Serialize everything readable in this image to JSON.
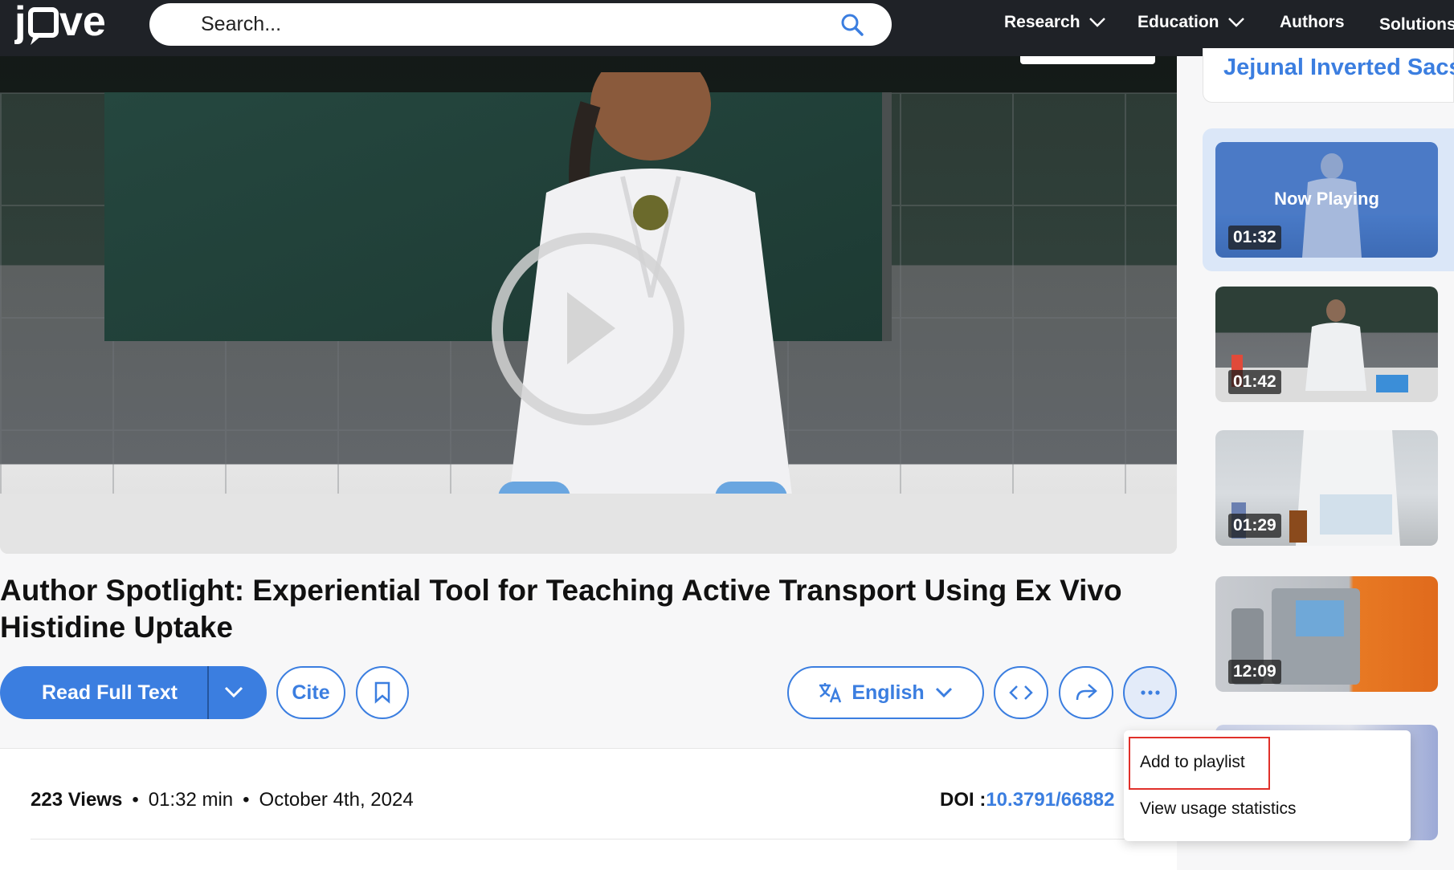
{
  "nav": {
    "logo": "jove",
    "search_placeholder": "Search...",
    "links": [
      "Research",
      "Education",
      "Authors",
      "Solutions"
    ]
  },
  "video": {
    "play_label": "Play video"
  },
  "article": {
    "title": "Author Spotlight: Experiential Tool for Teaching Active Transport Using Ex Vivo Histidine Uptake"
  },
  "actions": {
    "read_full_text": "Read Full Text",
    "cite": "Cite",
    "language": "English"
  },
  "info": {
    "views": "223 Views",
    "duration": "01:32 min",
    "date": "October 4th, 2024",
    "doi_label": "DOI :",
    "doi_value": "10.3791/66882"
  },
  "sidebar": {
    "top_title": "Jejunal Inverted Sacs",
    "now_playing": "Now Playing",
    "videos": [
      {
        "duration": "01:32"
      },
      {
        "duration": "01:42"
      },
      {
        "duration": "01:29"
      },
      {
        "duration": "12:09"
      }
    ]
  },
  "menu": {
    "items": [
      "Add to playlist",
      "View usage statistics"
    ]
  },
  "colors": {
    "nav_bg": "#1f2227",
    "accent": "#3b7ee0",
    "highlight": "#e0302a"
  }
}
